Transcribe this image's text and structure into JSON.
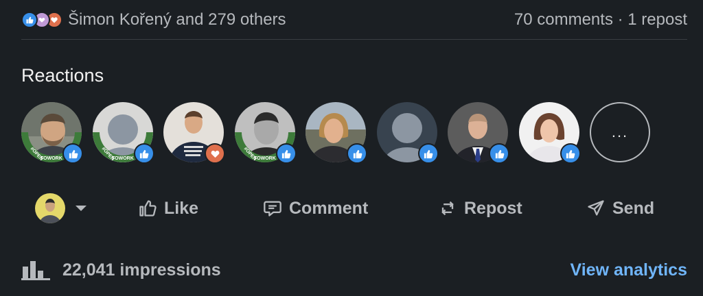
{
  "summary": {
    "reaction_icons": [
      "like-icon",
      "support-icon",
      "love-icon"
    ],
    "names_text": "Šimon Kořený and 279 others",
    "comments_text": "70 comments",
    "separator": " · ",
    "reposts_text": "1 repost"
  },
  "reactions": {
    "title": "Reactions",
    "people": [
      {
        "avatar": "photo-openToWork",
        "reaction": "like"
      },
      {
        "avatar": "placeholder-openToWork",
        "reaction": "like"
      },
      {
        "avatar": "photo",
        "reaction": "love"
      },
      {
        "avatar": "photo-openToWork",
        "reaction": "like"
      },
      {
        "avatar": "photo",
        "reaction": "like"
      },
      {
        "avatar": "placeholder",
        "reaction": "like"
      },
      {
        "avatar": "photo",
        "reaction": "like"
      },
      {
        "avatar": "photo",
        "reaction": "like"
      }
    ],
    "more_label": "..."
  },
  "actions": {
    "like_label": "Like",
    "comment_label": "Comment",
    "repost_label": "Repost",
    "send_label": "Send"
  },
  "footer": {
    "impressions_text": "22,041 impressions",
    "analytics_label": "View analytics"
  },
  "colors": {
    "background": "#1b1f23",
    "like": "#378fe9",
    "love": "#df704d",
    "link": "#70b5f9",
    "open_to_work": "#3d7b3a"
  }
}
